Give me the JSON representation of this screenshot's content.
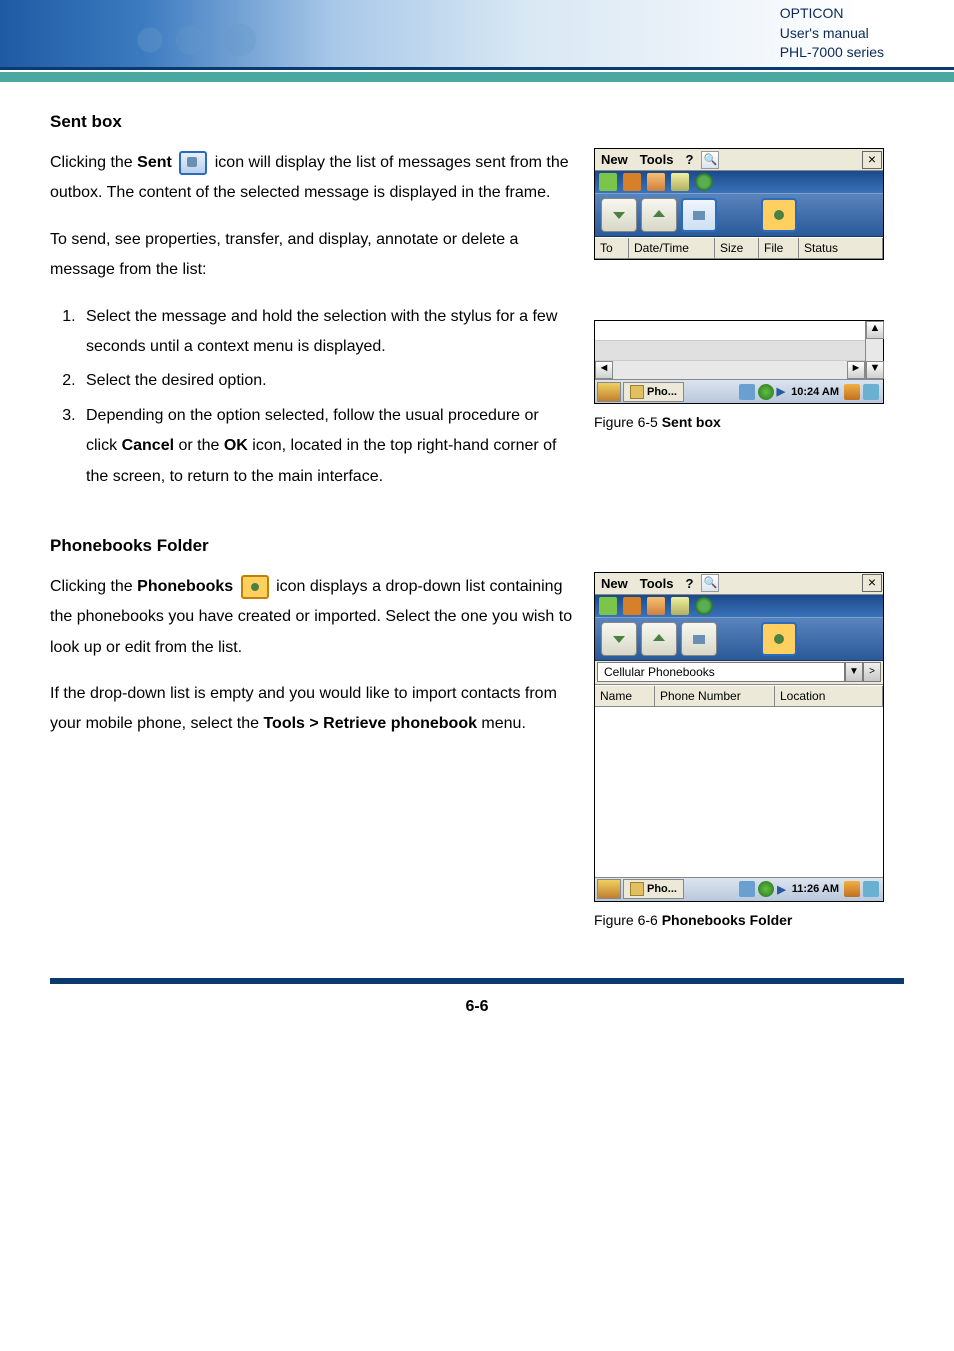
{
  "header": {
    "brand": "OPTICON",
    "manual": "User's manual",
    "series": "PHL-7000 series"
  },
  "section1": {
    "title": "Sent box",
    "p1_a": "Clicking the ",
    "p1_b": "Sent",
    "p1_c": " icon will display the list of messages sent from the outbox. The content of the selected message is displayed in the frame.",
    "p2": "To send, see properties, transfer, and display, annotate or delete a message from the list:",
    "steps": [
      "Select the message and hold the selection with the stylus for a few seconds until a context menu is displayed.",
      "Select the desired option.",
      "Depending on the option selected, follow the usual procedure or click Cancel or the OK icon, located in the top right-hand corner of the screen, to return to the main interface."
    ],
    "fig_label_a": "Figure 6-5 ",
    "fig_label_b": "Sent box"
  },
  "section2": {
    "title": "Phonebooks Folder",
    "p1_a": "Clicking the ",
    "p1_b": "Phonebooks",
    "p1_c": " icon displays a drop-down list containing the phonebooks you have created or imported. Select the one you wish to look up or edit from the list.",
    "p2_a": "If the drop-down list is empty and you would like to import contacts from your mobile phone, select the ",
    "p2_b": "Tools > Retrieve phonebook",
    "p2_c": " menu.",
    "fig_label_a": "Figure 6-6 ",
    "fig_label_b": "Phonebooks Folder"
  },
  "device1": {
    "menu_new": "New",
    "menu_tools": "Tools",
    "menu_help": "?",
    "close": "×",
    "headers": {
      "to": "To",
      "datetime": "Date/Time",
      "size": "Size",
      "file": "File",
      "status": "Status"
    }
  },
  "device2": {
    "menu_new": "New",
    "menu_tools": "Tools",
    "menu_help": "?",
    "close": "×",
    "dropdown_label": "Cellular Phonebooks",
    "headers": {
      "name": "Name",
      "phone": "Phone Number",
      "location": "Location"
    }
  },
  "taskbar1": {
    "app": "Pho...",
    "time": "10:24 AM"
  },
  "taskbar2": {
    "app": "Pho...",
    "time": "11:26 AM"
  },
  "page_number": "6-6"
}
